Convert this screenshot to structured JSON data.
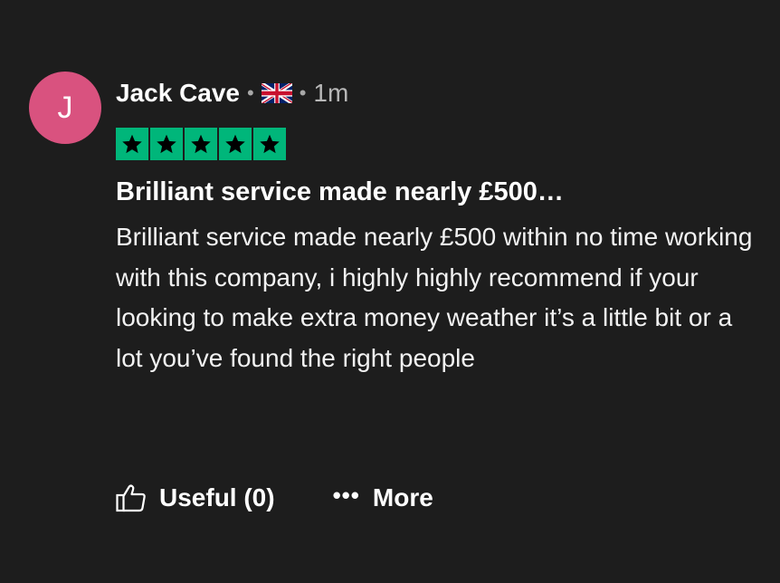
{
  "review": {
    "avatar_initial": "J",
    "avatar_color": "#d9527f",
    "author": "Jack Cave",
    "separator": "•",
    "country_flag": "uk-flag-icon",
    "time_ago": "1m",
    "rating": 5,
    "star_color": "#00b67a",
    "title": "Brilliant service made nearly £500…",
    "body": "Brilliant service made nearly £500 within no time working with this company, i highly highly recommend if your looking to make extra money weather it’s a little bit or a lot you’ve found the right people"
  },
  "actions": {
    "useful_label": "Useful (0)",
    "useful_icon": "thumbs-up-icon",
    "more_label": "More",
    "more_icon": "ellipsis-icon",
    "more_icon_glyph": "•••"
  }
}
